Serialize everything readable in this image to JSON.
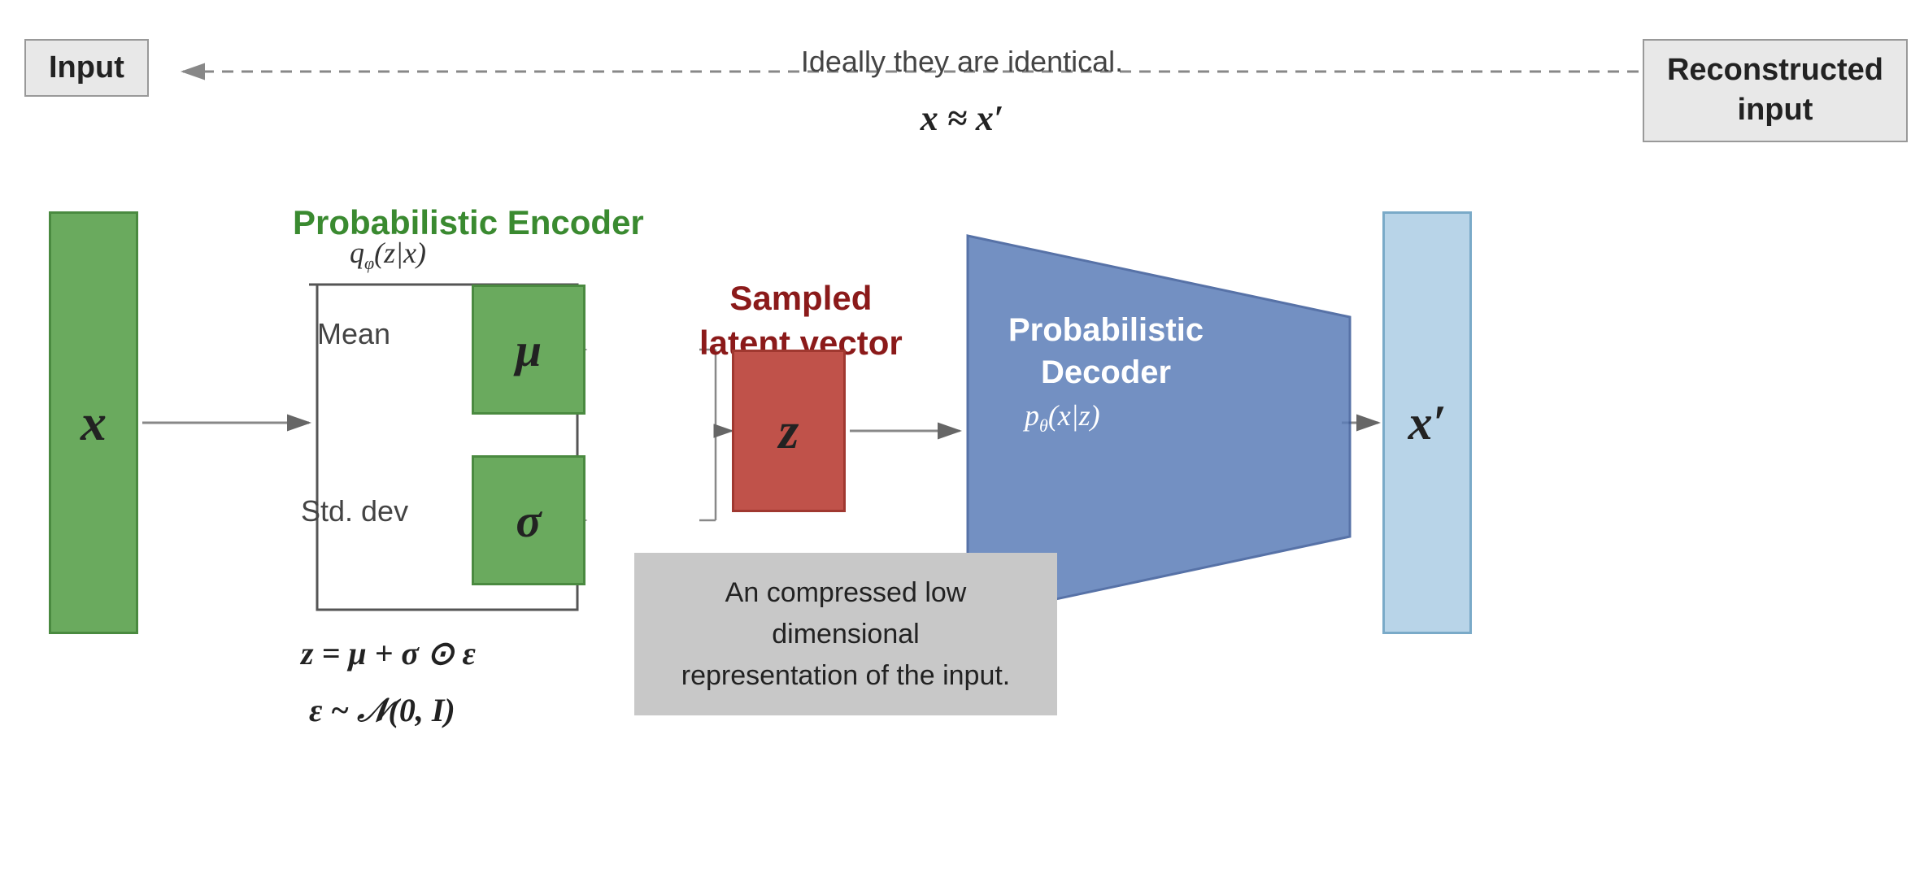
{
  "top": {
    "input_label": "Input",
    "reconstructed_label": "Reconstructed\ninput",
    "ideal_text": "Ideally they are identical.",
    "equation_top": "x ≈ x′"
  },
  "main": {
    "input_symbol": "x",
    "output_symbol": "x′",
    "prob_encoder_label": "Probabilistic Encoder",
    "encoder_formula": "qφ(z|x)",
    "mean_label": "Mean",
    "stddev_label": "Std. dev",
    "mu_symbol": "μ",
    "sigma_symbol": "σ",
    "z_symbol": "z",
    "sampled_label": "Sampled\nlatent vector",
    "prob_decoder_label": "Probabilistic\nDecoder",
    "decoder_formula": "pθ(x|z)",
    "z_equation": "z = μ + σ ⊙ ε",
    "epsilon_equation": "ε ~ N(0, I)",
    "callout_text": "An compressed low dimensional\nrepresentation of the input."
  }
}
